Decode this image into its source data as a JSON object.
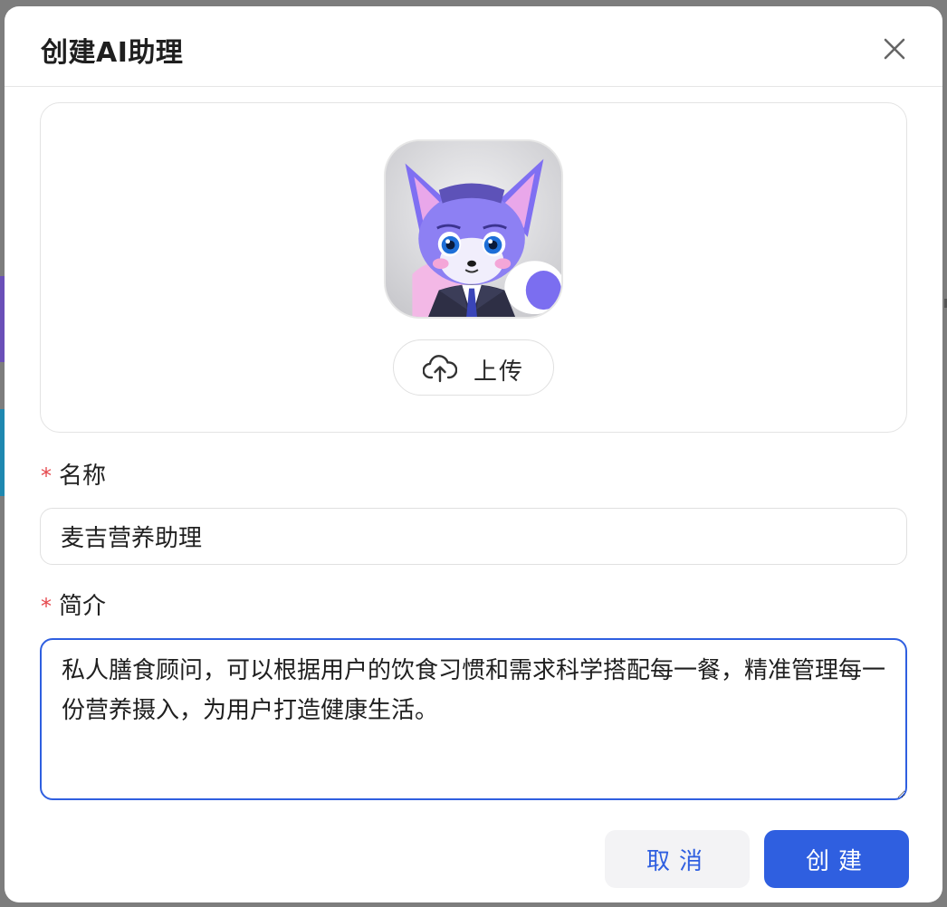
{
  "dialog": {
    "title": "创建AI助理",
    "close_icon": "close-icon"
  },
  "avatar": {
    "image": "fox-avatar-image",
    "upload_label": "上传",
    "upload_icon": "cloud-upload-icon"
  },
  "form": {
    "name_label": "名称",
    "name_required": "*",
    "name_value": "麦吉营养助理",
    "desc_label": "简介",
    "desc_required": "*",
    "desc_value": "私人膳食顾问，可以根据用户的饮食习惯和需求科学搭配每一餐，精准管理每一份营养摄入，为用户打造健康生活。"
  },
  "actions": {
    "cancel_label": "取消",
    "create_label": "创建"
  },
  "colors": {
    "accent": "#2f5fe0",
    "required": "#e5484d"
  }
}
